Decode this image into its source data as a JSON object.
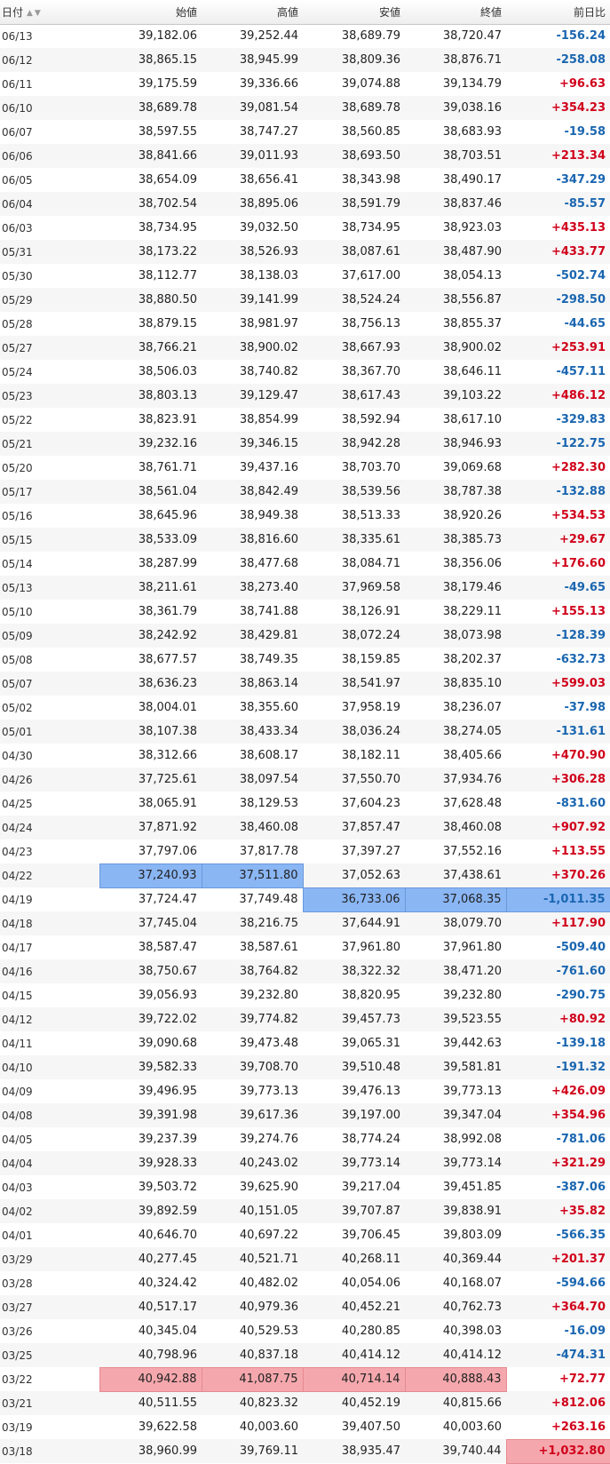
{
  "headers": {
    "date": "日付",
    "open": "始値",
    "high": "高値",
    "low": "安値",
    "close": "終値",
    "change": "前日比"
  },
  "sort_icons": "▲▼",
  "colors": {
    "up": "#d0021b",
    "down": "#1a66b0",
    "highlight_blue": "#8ab6f4",
    "highlight_red": "#f4a8ad"
  },
  "rows": [
    {
      "date": "06/13",
      "open": "39,182.06",
      "high": "39,252.44",
      "low": "38,689.79",
      "close": "38,720.47",
      "change": "-156.24"
    },
    {
      "date": "06/12",
      "open": "38,865.15",
      "high": "38,945.99",
      "low": "38,809.36",
      "close": "38,876.71",
      "change": "-258.08"
    },
    {
      "date": "06/11",
      "open": "39,175.59",
      "high": "39,336.66",
      "low": "39,074.88",
      "close": "39,134.79",
      "change": "+96.63"
    },
    {
      "date": "06/10",
      "open": "38,689.78",
      "high": "39,081.54",
      "low": "38,689.78",
      "close": "39,038.16",
      "change": "+354.23"
    },
    {
      "date": "06/07",
      "open": "38,597.55",
      "high": "38,747.27",
      "low": "38,560.85",
      "close": "38,683.93",
      "change": "-19.58"
    },
    {
      "date": "06/06",
      "open": "38,841.66",
      "high": "39,011.93",
      "low": "38,693.50",
      "close": "38,703.51",
      "change": "+213.34"
    },
    {
      "date": "06/05",
      "open": "38,654.09",
      "high": "38,656.41",
      "low": "38,343.98",
      "close": "38,490.17",
      "change": "-347.29"
    },
    {
      "date": "06/04",
      "open": "38,702.54",
      "high": "38,895.06",
      "low": "38,591.79",
      "close": "38,837.46",
      "change": "-85.57"
    },
    {
      "date": "06/03",
      "open": "38,734.95",
      "high": "39,032.50",
      "low": "38,734.95",
      "close": "38,923.03",
      "change": "+435.13"
    },
    {
      "date": "05/31",
      "open": "38,173.22",
      "high": "38,526.93",
      "low": "38,087.61",
      "close": "38,487.90",
      "change": "+433.77"
    },
    {
      "date": "05/30",
      "open": "38,112.77",
      "high": "38,138.03",
      "low": "37,617.00",
      "close": "38,054.13",
      "change": "-502.74"
    },
    {
      "date": "05/29",
      "open": "38,880.50",
      "high": "39,141.99",
      "low": "38,524.24",
      "close": "38,556.87",
      "change": "-298.50"
    },
    {
      "date": "05/28",
      "open": "38,879.15",
      "high": "38,981.97",
      "low": "38,756.13",
      "close": "38,855.37",
      "change": "-44.65"
    },
    {
      "date": "05/27",
      "open": "38,766.21",
      "high": "38,900.02",
      "low": "38,667.93",
      "close": "38,900.02",
      "change": "+253.91"
    },
    {
      "date": "05/24",
      "open": "38,506.03",
      "high": "38,740.82",
      "low": "38,367.70",
      "close": "38,646.11",
      "change": "-457.11"
    },
    {
      "date": "05/23",
      "open": "38,803.13",
      "high": "39,129.47",
      "low": "38,617.43",
      "close": "39,103.22",
      "change": "+486.12"
    },
    {
      "date": "05/22",
      "open": "38,823.91",
      "high": "38,854.99",
      "low": "38,592.94",
      "close": "38,617.10",
      "change": "-329.83"
    },
    {
      "date": "05/21",
      "open": "39,232.16",
      "high": "39,346.15",
      "low": "38,942.28",
      "close": "38,946.93",
      "change": "-122.75"
    },
    {
      "date": "05/20",
      "open": "38,761.71",
      "high": "39,437.16",
      "low": "38,703.70",
      "close": "39,069.68",
      "change": "+282.30"
    },
    {
      "date": "05/17",
      "open": "38,561.04",
      "high": "38,842.49",
      "low": "38,539.56",
      "close": "38,787.38",
      "change": "-132.88"
    },
    {
      "date": "05/16",
      "open": "38,645.96",
      "high": "38,949.38",
      "low": "38,513.33",
      "close": "38,920.26",
      "change": "+534.53"
    },
    {
      "date": "05/15",
      "open": "38,533.09",
      "high": "38,816.60",
      "low": "38,335.61",
      "close": "38,385.73",
      "change": "+29.67"
    },
    {
      "date": "05/14",
      "open": "38,287.99",
      "high": "38,477.68",
      "low": "38,084.71",
      "close": "38,356.06",
      "change": "+176.60"
    },
    {
      "date": "05/13",
      "open": "38,211.61",
      "high": "38,273.40",
      "low": "37,969.58",
      "close": "38,179.46",
      "change": "-49.65"
    },
    {
      "date": "05/10",
      "open": "38,361.79",
      "high": "38,741.88",
      "low": "38,126.91",
      "close": "38,229.11",
      "change": "+155.13"
    },
    {
      "date": "05/09",
      "open": "38,242.92",
      "high": "38,429.81",
      "low": "38,072.24",
      "close": "38,073.98",
      "change": "-128.39"
    },
    {
      "date": "05/08",
      "open": "38,677.57",
      "high": "38,749.35",
      "low": "38,159.85",
      "close": "38,202.37",
      "change": "-632.73"
    },
    {
      "date": "05/07",
      "open": "38,636.23",
      "high": "38,863.14",
      "low": "38,541.97",
      "close": "38,835.10",
      "change": "+599.03"
    },
    {
      "date": "05/02",
      "open": "38,004.01",
      "high": "38,355.60",
      "low": "37,958.19",
      "close": "38,236.07",
      "change": "-37.98"
    },
    {
      "date": "05/01",
      "open": "38,107.38",
      "high": "38,433.34",
      "low": "38,036.24",
      "close": "38,274.05",
      "change": "-131.61"
    },
    {
      "date": "04/30",
      "open": "38,312.66",
      "high": "38,608.17",
      "low": "38,182.11",
      "close": "38,405.66",
      "change": "+470.90"
    },
    {
      "date": "04/26",
      "open": "37,725.61",
      "high": "38,097.54",
      "low": "37,550.70",
      "close": "37,934.76",
      "change": "+306.28"
    },
    {
      "date": "04/25",
      "open": "38,065.91",
      "high": "38,129.53",
      "low": "37,604.23",
      "close": "37,628.48",
      "change": "-831.60"
    },
    {
      "date": "04/24",
      "open": "37,871.92",
      "high": "38,460.08",
      "low": "37,857.47",
      "close": "38,460.08",
      "change": "+907.92"
    },
    {
      "date": "04/23",
      "open": "37,797.06",
      "high": "37,817.78",
      "low": "37,397.27",
      "close": "37,552.16",
      "change": "+113.55"
    },
    {
      "date": "04/22",
      "open": "37,240.93",
      "high": "37,511.80",
      "low": "37,052.63",
      "close": "37,438.61",
      "change": "+370.26"
    },
    {
      "date": "04/19",
      "open": "37,724.47",
      "high": "37,749.48",
      "low": "36,733.06",
      "close": "37,068.35",
      "change": "-1,011.35"
    },
    {
      "date": "04/18",
      "open": "37,745.04",
      "high": "38,216.75",
      "low": "37,644.91",
      "close": "38,079.70",
      "change": "+117.90"
    },
    {
      "date": "04/17",
      "open": "38,587.47",
      "high": "38,587.61",
      "low": "37,961.80",
      "close": "37,961.80",
      "change": "-509.40"
    },
    {
      "date": "04/16",
      "open": "38,750.67",
      "high": "38,764.82",
      "low": "38,322.32",
      "close": "38,471.20",
      "change": "-761.60"
    },
    {
      "date": "04/15",
      "open": "39,056.93",
      "high": "39,232.80",
      "low": "38,820.95",
      "close": "39,232.80",
      "change": "-290.75"
    },
    {
      "date": "04/12",
      "open": "39,722.02",
      "high": "39,774.82",
      "low": "39,457.73",
      "close": "39,523.55",
      "change": "+80.92"
    },
    {
      "date": "04/11",
      "open": "39,090.68",
      "high": "39,473.48",
      "low": "39,065.31",
      "close": "39,442.63",
      "change": "-139.18"
    },
    {
      "date": "04/10",
      "open": "39,582.33",
      "high": "39,708.70",
      "low": "39,510.48",
      "close": "39,581.81",
      "change": "-191.32"
    },
    {
      "date": "04/09",
      "open": "39,496.95",
      "high": "39,773.13",
      "low": "39,476.13",
      "close": "39,773.13",
      "change": "+426.09"
    },
    {
      "date": "04/08",
      "open": "39,391.98",
      "high": "39,617.36",
      "low": "39,197.00",
      "close": "39,347.04",
      "change": "+354.96"
    },
    {
      "date": "04/05",
      "open": "39,237.39",
      "high": "39,274.76",
      "low": "38,774.24",
      "close": "38,992.08",
      "change": "-781.06"
    },
    {
      "date": "04/04",
      "open": "39,928.33",
      "high": "40,243.02",
      "low": "39,773.14",
      "close": "39,773.14",
      "change": "+321.29"
    },
    {
      "date": "04/03",
      "open": "39,503.72",
      "high": "39,625.90",
      "low": "39,217.04",
      "close": "39,451.85",
      "change": "-387.06"
    },
    {
      "date": "04/02",
      "open": "39,892.59",
      "high": "40,151.05",
      "low": "39,707.87",
      "close": "39,838.91",
      "change": "+35.82"
    },
    {
      "date": "04/01",
      "open": "40,646.70",
      "high": "40,697.22",
      "low": "39,706.45",
      "close": "39,803.09",
      "change": "-566.35"
    },
    {
      "date": "03/29",
      "open": "40,277.45",
      "high": "40,521.71",
      "low": "40,268.11",
      "close": "40,369.44",
      "change": "+201.37"
    },
    {
      "date": "03/28",
      "open": "40,324.42",
      "high": "40,482.02",
      "low": "40,054.06",
      "close": "40,168.07",
      "change": "-594.66"
    },
    {
      "date": "03/27",
      "open": "40,517.17",
      "high": "40,979.36",
      "low": "40,452.21",
      "close": "40,762.73",
      "change": "+364.70"
    },
    {
      "date": "03/26",
      "open": "40,345.04",
      "high": "40,529.53",
      "low": "40,280.85",
      "close": "40,398.03",
      "change": "-16.09"
    },
    {
      "date": "03/25",
      "open": "40,798.96",
      "high": "40,837.18",
      "low": "40,414.12",
      "close": "40,414.12",
      "change": "-474.31"
    },
    {
      "date": "03/22",
      "open": "40,942.88",
      "high": "41,087.75",
      "low": "40,714.14",
      "close": "40,888.43",
      "change": "+72.77"
    },
    {
      "date": "03/21",
      "open": "40,511.55",
      "high": "40,823.32",
      "low": "40,452.19",
      "close": "40,815.66",
      "change": "+812.06"
    },
    {
      "date": "03/19",
      "open": "39,622.58",
      "high": "40,003.60",
      "low": "39,407.50",
      "close": "40,003.60",
      "change": "+263.16"
    },
    {
      "date": "03/18",
      "open": "38,960.99",
      "high": "39,769.11",
      "low": "38,935.47",
      "close": "39,740.44",
      "change": "+1,032.80"
    }
  ],
  "highlights": [
    {
      "row": "04/22",
      "cols": [
        "open",
        "high"
      ],
      "color": "blue"
    },
    {
      "row": "04/19",
      "cols": [
        "low",
        "close",
        "change"
      ],
      "color": "blue"
    },
    {
      "row": "03/22",
      "cols": [
        "open",
        "high",
        "low",
        "close"
      ],
      "color": "red"
    },
    {
      "row": "03/18",
      "cols": [
        "change"
      ],
      "color": "red"
    }
  ]
}
